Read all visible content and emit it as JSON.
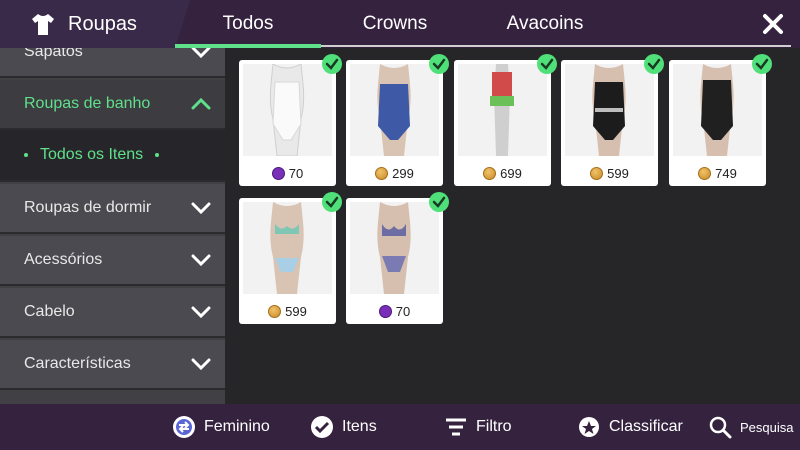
{
  "header": {
    "section_title": "Roupas",
    "tabs": [
      {
        "label": "Todos",
        "selected": true
      },
      {
        "label": "Crowns",
        "selected": false
      },
      {
        "label": "Avacoins",
        "selected": false
      }
    ],
    "close_icon": "close-icon",
    "section_icon": "shirt-icon"
  },
  "sidebar": {
    "items": [
      {
        "label": "Sapatos"
      },
      {
        "label": "Roupas de banho",
        "expanded": true
      },
      {
        "label": "Roupas de dormir"
      },
      {
        "label": "Acessórios"
      },
      {
        "label": "Cabelo"
      },
      {
        "label": "Características"
      }
    ],
    "sub_item": {
      "label": "Todos os Itens"
    }
  },
  "items": [
    {
      "price": "70",
      "currency": "crown",
      "owned": true
    },
    {
      "price": "299",
      "currency": "avacoin",
      "owned": true
    },
    {
      "price": "699",
      "currency": "avacoin",
      "owned": true
    },
    {
      "price": "599",
      "currency": "avacoin",
      "owned": true
    },
    {
      "price": "749",
      "currency": "avacoin",
      "owned": true
    },
    {
      "price": "599",
      "currency": "avacoin",
      "owned": true
    },
    {
      "price": "70",
      "currency": "crown",
      "owned": true
    }
  ],
  "bottom_bar": {
    "gender": "Feminino",
    "items": "Itens",
    "filter": "Filtro",
    "sort": "Classificar",
    "search": "Pesquisa"
  },
  "colors": {
    "accent": "#5fe08a",
    "header_bg": "#35223f",
    "sidebar_bg": "#4a4a50",
    "check": "#4fe07a"
  }
}
